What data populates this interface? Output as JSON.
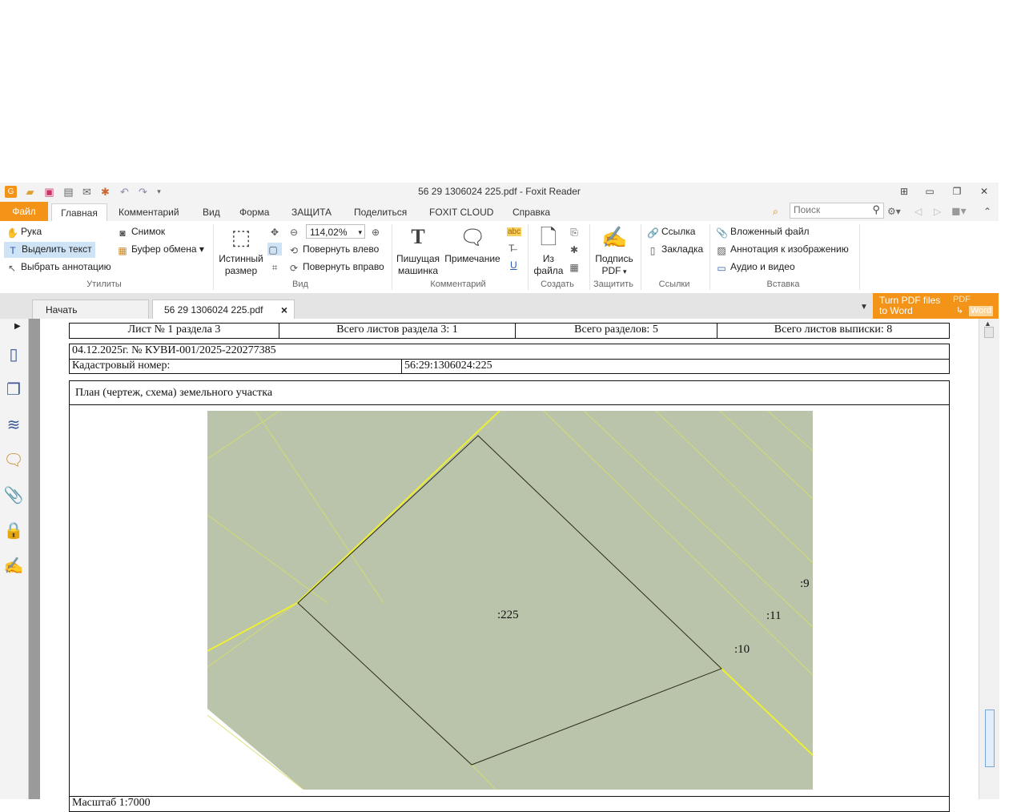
{
  "window": {
    "title": "56 29 1306024 225.pdf - Foxit Reader",
    "quick_access": [
      "app-icon",
      "open-icon",
      "save-icon",
      "print-icon",
      "email-icon",
      "new-icon",
      "undo-icon",
      "redo-icon",
      "customize-icon"
    ]
  },
  "ribbon_tabs": [
    "Файл",
    "Главная",
    "Комментарий",
    "Вид",
    "Форма",
    "ЗАЩИТА",
    "Поделиться",
    "FOXIT CLOUD",
    "Справка"
  ],
  "search": {
    "placeholder": "Поиск"
  },
  "ribbon": {
    "tools": {
      "hand": "Рука",
      "select_text": "Выделить текст",
      "select_annotation": "Выбрать аннотацию",
      "snapshot": "Снимок",
      "clipboard": "Буфер обмена",
      "group": "Утилиты"
    },
    "view": {
      "actual_size_1": "Истинный",
      "actual_size_2": "размер",
      "zoom": "114,02%",
      "rotate_left": "Повернуть влево",
      "rotate_right": "Повернуть вправо",
      "group": "Вид"
    },
    "comment": {
      "typewriter_1": "Пишущая",
      "typewriter_2": "машинка",
      "note": "Примечание",
      "abc": "abc",
      "group": "Комментарий"
    },
    "create": {
      "from_file_1": "Из",
      "from_file_2": "файла",
      "group": "Создать"
    },
    "protect": {
      "sign_1": "Подпись",
      "sign_2": "PDF",
      "group": "Защитить"
    },
    "links": {
      "link": "Ссылка",
      "bookmark": "Закладка",
      "group": "Ссылки"
    },
    "insert": {
      "attachment": "Вложенный файл",
      "image_annotation": "Аннотация к изображению",
      "audio_video": "Аудио и видео",
      "group": "Вставка"
    }
  },
  "doc_tabs": {
    "start": "Начать",
    "file": "56 29 1306024 225.pdf",
    "close": "×"
  },
  "promo": {
    "line1": "Turn PDF files",
    "line2": "to Word",
    "badge1": "PDF",
    "badge2": "Word"
  },
  "document": {
    "header_cells": [
      "Лист № 1 раздела 3",
      "Всего листов раздела 3: 1",
      "Всего разделов: 5",
      "Всего листов выписки: 8"
    ],
    "date_number": "04.12.2025г. № КУВИ-001/2025-220277385",
    "cadastral_label": "Кадастровый номер:",
    "cadastral_value": "56:29:1306024:225",
    "plan_title": "План (чертеж, схема) земельного участка",
    "map_labels": [
      ":225",
      ":9",
      ":11",
      ":10"
    ],
    "bottom_partial": "Масштаб 1:7000"
  },
  "colors": {
    "accent": "#f39318",
    "map_fill": "#b9c4ab",
    "parcel_line": "#e8e832"
  }
}
